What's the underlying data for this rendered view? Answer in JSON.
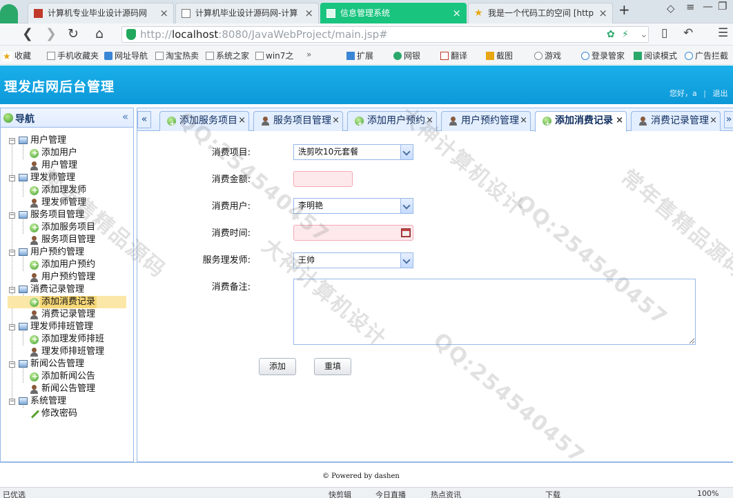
{
  "browser": {
    "tabs": [
      {
        "title": "计算机专业毕业设计源码网"
      },
      {
        "title": "计算机毕业设计源码网-计算"
      },
      {
        "title": "信息管理系统"
      },
      {
        "title": "我是一个代码工的空间 [http"
      }
    ],
    "new_tab": "+",
    "url_prefix": "http://",
    "url_host": "localhost",
    "url_rest": ":8080/JavaWebProject/main.jsp#",
    "bookmarks": [
      "收藏",
      "手机收藏夹",
      "网址导航",
      "淘宝热卖",
      "系统之家",
      "win7之"
    ],
    "toolbar_items": [
      "扩展",
      "网银",
      "翻译",
      "截图",
      "游戏",
      "登录管家",
      "阅读模式",
      "广告拦截"
    ]
  },
  "app": {
    "title": "理发店网后台管理",
    "greeting": "您好，a",
    "logout": "退出"
  },
  "nav": {
    "title": "导航",
    "groups": [
      {
        "label": "用户管理",
        "items": [
          "添加用户",
          "用户管理"
        ]
      },
      {
        "label": "理发师管理",
        "items": [
          "添加理发师",
          "理发师管理"
        ]
      },
      {
        "label": "服务项目管理",
        "items": [
          "添加服务项目",
          "服务项目管理"
        ]
      },
      {
        "label": "用户预约管理",
        "items": [
          "添加用户预约",
          "用户预约管理"
        ]
      },
      {
        "label": "消费记录管理",
        "items": [
          "添加消费记录",
          "消费记录管理"
        ]
      },
      {
        "label": "理发师排班管理",
        "items": [
          "添加理发师排班",
          "理发师排班管理"
        ]
      },
      {
        "label": "新闻公告管理",
        "items": [
          "添加新闻公告",
          "新闻公告管理"
        ]
      },
      {
        "label": "系统管理",
        "items": [
          "修改密码"
        ]
      }
    ]
  },
  "tabs": [
    {
      "label": "添加服务项目"
    },
    {
      "label": "服务项目管理"
    },
    {
      "label": "添加用户预约"
    },
    {
      "label": "用户预约管理"
    },
    {
      "label": "添加消费记录"
    },
    {
      "label": "消费记录管理"
    }
  ],
  "form": {
    "item_label": "消费项目:",
    "item_value": "洗剪吹10元套餐",
    "amount_label": "消费金额:",
    "amount_value": "",
    "user_label": "消费用户:",
    "user_value": "李明艳",
    "time_label": "消费时间:",
    "time_value": "",
    "barber_label": "服务理发师:",
    "barber_value": "王帅",
    "memo_label": "消费备注:",
    "memo_value": "",
    "add_button": "添加",
    "reset_button": "重填"
  },
  "footer": {
    "powered": "© Powered by dashen"
  },
  "status": {
    "left": "已优选",
    "items": [
      "快剪辑",
      "今日直播",
      "热点资讯"
    ],
    "zoom": "100%",
    "download": "下载"
  },
  "watermarks": [
    "大神计算机设计",
    "QQ:254540457",
    "常年售精品源码"
  ]
}
